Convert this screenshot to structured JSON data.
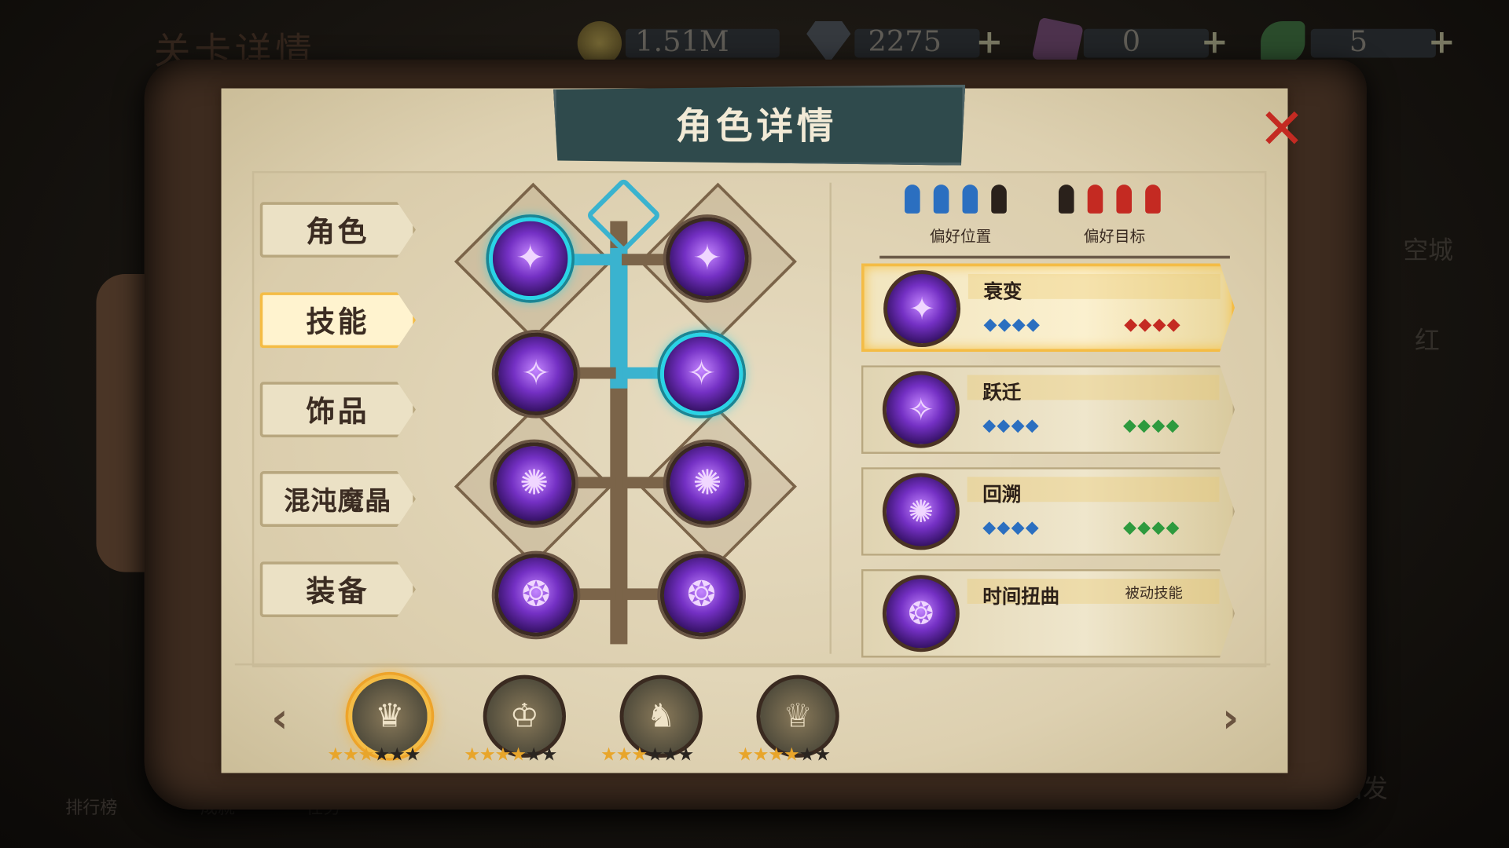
{
  "topbar": {
    "bg_title": "关卡详情",
    "gold": "1.51M",
    "gems": "2275",
    "runes": "0",
    "leaves": "5",
    "plus": "+"
  },
  "background": {
    "right_labels": [
      "空城",
      "红"
    ],
    "bottom_labels": [
      "排行榜",
      "成就",
      "任务"
    ],
    "start": "出发"
  },
  "dialog": {
    "title": "角色详情",
    "close": "✕"
  },
  "tabs": [
    {
      "label": "角色",
      "active": false
    },
    {
      "label": "技能",
      "active": true
    },
    {
      "label": "饰品",
      "active": false
    },
    {
      "label": "混沌魔晶",
      "active": false
    },
    {
      "label": "装备",
      "active": false
    }
  ],
  "prefs": {
    "position_label": "偏好位置",
    "target_label": "偏好目标"
  },
  "skills": [
    {
      "name": "衰变",
      "type": "",
      "left_dots": "◆◆◆◆",
      "right_dots": "◆◆◆◆",
      "left_color": "#2b6fc0",
      "right_color": "#c42a22",
      "active": true
    },
    {
      "name": "跃迁",
      "type": "",
      "left_dots": "◆◆◆◆",
      "right_dots": "◆◆◆◆",
      "left_color": "#2b6fc0",
      "right_color": "#2e9a3e",
      "active": false
    },
    {
      "name": "回溯",
      "type": "",
      "left_dots": "◆◆◆◆",
      "right_dots": "◆◆◆◆",
      "left_color": "#2b6fc0",
      "right_color": "#2e9a3e",
      "active": false
    },
    {
      "name": "时间扭曲",
      "type": "被动技能",
      "left_dots": "",
      "right_dots": "",
      "active": false
    }
  ],
  "heroes": [
    {
      "name": "hero-1",
      "stars_on": 3,
      "stars_total": 6,
      "selected": true
    },
    {
      "name": "hero-2",
      "stars_on": 4,
      "stars_total": 6,
      "selected": false
    },
    {
      "name": "hero-3",
      "stars_on": 3,
      "stars_total": 6,
      "selected": false
    },
    {
      "name": "hero-4",
      "stars_on": 4,
      "stars_total": 6,
      "selected": false
    }
  ],
  "nav": {
    "prev": "‹",
    "next": "›"
  }
}
